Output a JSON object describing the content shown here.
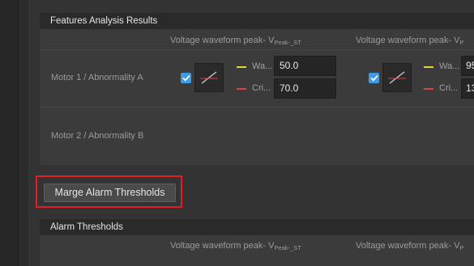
{
  "features_panel": {
    "title": "Features Analysis Results",
    "columns": [
      {
        "label": "Voltage waveform peak-",
        "symbol": "V",
        "subscript": "Peak-_ST"
      },
      {
        "label": "Voltage waveform peak-",
        "symbol": "V",
        "subscript": "P"
      }
    ],
    "rows": [
      {
        "label": "Motor 1 / Abnormality A",
        "cells": [
          {
            "checked": true,
            "warning_label": "Wa...",
            "critical_label": "Cri...",
            "warning_value": "50.0",
            "critical_value": "70.0"
          },
          {
            "checked": true,
            "warning_label": "Wa...",
            "critical_label": "Cri...",
            "warning_value": "95",
            "critical_value": "13"
          }
        ]
      },
      {
        "label": "Motor 2 / Abnormality B"
      }
    ]
  },
  "merge_button": {
    "label": "Marge Alarm Thresholds"
  },
  "alarm_panel": {
    "title": "Alarm Thresholds",
    "columns": [
      {
        "label": "Voltage waveform peak-",
        "symbol": "V",
        "subscript": "Peak-_ST"
      },
      {
        "label": "Voltage waveform peak-",
        "symbol": "V",
        "subscript": "P"
      }
    ]
  },
  "colors": {
    "warning": "#e8d33a",
    "critical": "#e0404a",
    "checkbox": "#3f9be3",
    "highlight": "#e21f26"
  }
}
